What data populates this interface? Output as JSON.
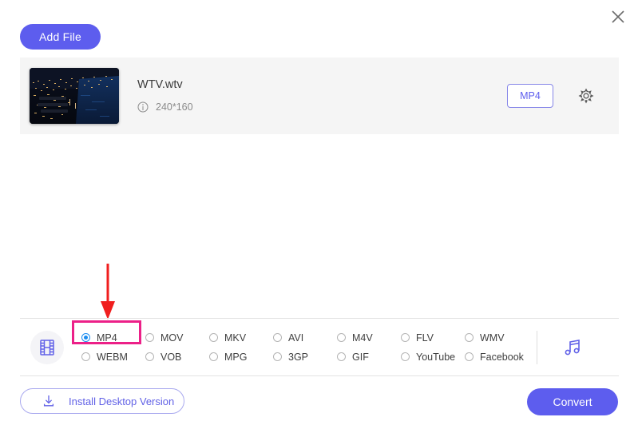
{
  "window": {
    "close_label": "×"
  },
  "toolbar": {
    "add_file_label": "Add File"
  },
  "file": {
    "name": "WTV.wtv",
    "resolution": "240*160",
    "output_format_chip": "MP4",
    "thumbnail_alt": "night-city-harbor-aerial"
  },
  "format_bar": {
    "video_groups": [
      [
        {
          "label": "MP4",
          "selected": true
        },
        {
          "label": "WEBM",
          "selected": false
        }
      ],
      [
        {
          "label": "MOV",
          "selected": false
        },
        {
          "label": "VOB",
          "selected": false
        }
      ],
      [
        {
          "label": "MKV",
          "selected": false
        },
        {
          "label": "MPG",
          "selected": false
        }
      ],
      [
        {
          "label": "AVI",
          "selected": false
        },
        {
          "label": "3GP",
          "selected": false
        }
      ],
      [
        {
          "label": "M4V",
          "selected": false
        },
        {
          "label": "GIF",
          "selected": false
        }
      ],
      [
        {
          "label": "FLV",
          "selected": false
        },
        {
          "label": "YouTube",
          "selected": false
        }
      ],
      [
        {
          "label": "WMV",
          "selected": false
        },
        {
          "label": "Facebook",
          "selected": false
        }
      ]
    ]
  },
  "footer": {
    "install_label": "Install Desktop Version",
    "convert_label": "Convert"
  },
  "colors": {
    "accent_purple": "#5D5DEE",
    "highlight_magenta": "#EC2088",
    "annotation_red": "#F01E1E",
    "radio_selected_blue": "#1A8CF0",
    "row_background": "#F5F5F5"
  }
}
